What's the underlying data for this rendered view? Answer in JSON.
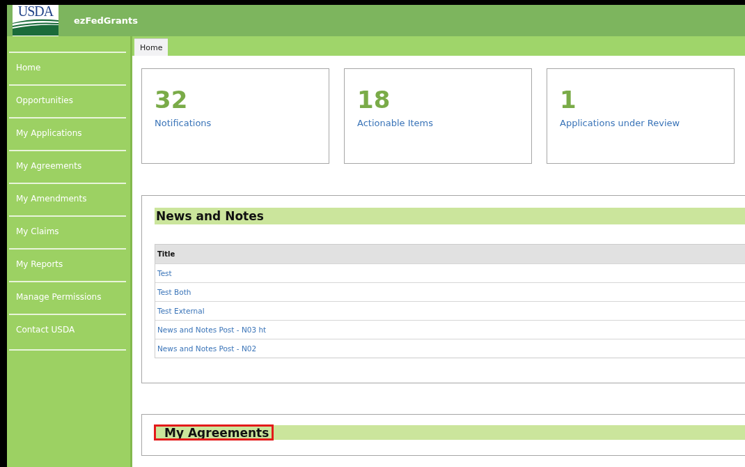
{
  "header": {
    "logo_text": "USDA",
    "app_name": "ezFedGrants"
  },
  "sidebar": {
    "items": [
      {
        "label": "Home"
      },
      {
        "label": "Opportunities"
      },
      {
        "label": "My Applications"
      },
      {
        "label": "My Agreements"
      },
      {
        "label": "My Amendments"
      },
      {
        "label": "My Claims"
      },
      {
        "label": "My Reports"
      },
      {
        "label": "Manage Permissions"
      },
      {
        "label": "Contact USDA"
      }
    ]
  },
  "tabs": [
    {
      "label": "Home",
      "selected": true
    }
  ],
  "summary_cards": [
    {
      "count": "32",
      "label": "Notifications"
    },
    {
      "count": "18",
      "label": "Actionable Items"
    },
    {
      "count": "1",
      "label": "Applications under Review"
    }
  ],
  "news_and_notes": {
    "title": "News and Notes",
    "table": {
      "columns": [
        "Title"
      ],
      "rows": [
        [
          "Test"
        ],
        [
          "Test Both"
        ],
        [
          "Test External"
        ],
        [
          "News and Notes Post - N03 ht"
        ],
        [
          "News and Notes Post - N02"
        ]
      ]
    }
  },
  "my_agreements": {
    "title": "My Agreements",
    "highlighted": true
  }
}
